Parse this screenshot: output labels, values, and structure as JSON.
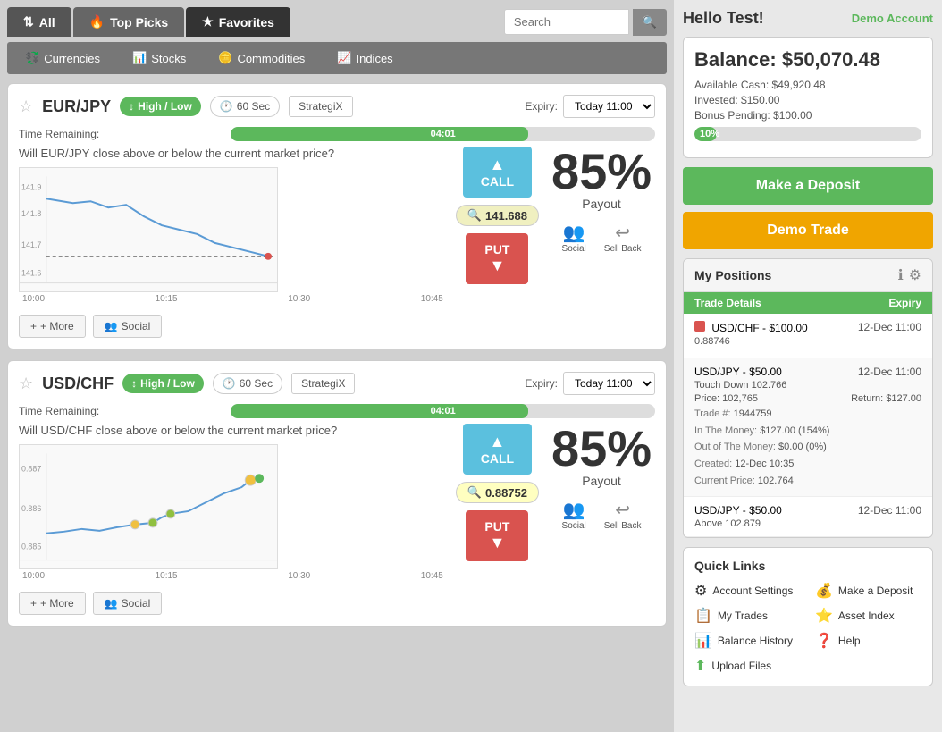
{
  "header": {
    "tabs": [
      {
        "id": "all",
        "label": "All",
        "icon": "⇅",
        "active": false
      },
      {
        "id": "toppicks",
        "label": "Top Picks",
        "icon": "🔥",
        "active": false
      },
      {
        "id": "favorites",
        "label": "Favorites",
        "icon": "★",
        "active": true
      }
    ],
    "search": {
      "placeholder": "Search",
      "button_icon": "🔍"
    },
    "subtabs": [
      {
        "id": "currencies",
        "label": "Currencies",
        "icon": "💱",
        "active": false
      },
      {
        "id": "stocks",
        "label": "Stocks",
        "icon": "📊",
        "active": false
      },
      {
        "id": "commodities",
        "label": "Commodities",
        "icon": "🪙",
        "active": false
      },
      {
        "id": "indices",
        "label": "Indices",
        "icon": "📈",
        "active": false
      }
    ]
  },
  "trades": [
    {
      "id": "eur-jpy",
      "asset": "EUR/JPY",
      "type": "High / Low",
      "duration": "60 Sec",
      "strategy": "StrategiX",
      "expiry_label": "Expiry:",
      "expiry_value": "Today 11:00",
      "question": "Will EUR/JPY close above or below the current market price?",
      "time_remaining_label": "Time Remaining:",
      "time_remaining_value": "04:01",
      "time_bar_pct": 70,
      "price": "141.688",
      "payout": "85%",
      "payout_label": "Payout",
      "call_label": "CALL",
      "put_label": "PUT",
      "social_label": "Social",
      "sellback_label": "Sell Back",
      "more_label": "+ More",
      "chart": {
        "y_labels": [
          "141.9",
          "141.8",
          "141.7",
          "141.6"
        ],
        "x_labels": [
          "10:00",
          "10:15",
          "10:30",
          "10:45"
        ]
      }
    },
    {
      "id": "usd-chf",
      "asset": "USD/CHF",
      "type": "High / Low",
      "duration": "60 Sec",
      "strategy": "StrategiX",
      "expiry_label": "Expiry:",
      "expiry_value": "Today 11:00",
      "question": "Will USD/CHF close above or below the current market price?",
      "time_remaining_label": "Time Remaining:",
      "time_remaining_value": "04:01",
      "time_bar_pct": 70,
      "price": "0.88752",
      "payout": "85%",
      "payout_label": "Payout",
      "call_label": "CALL",
      "put_label": "PUT",
      "social_label": "Social",
      "sellback_label": "Sell Back",
      "more_label": "+ More",
      "chart": {
        "y_labels": [
          "0.887",
          "0.886",
          "0.885"
        ],
        "x_labels": [
          "10:00",
          "10:15",
          "10:30",
          "10:45"
        ]
      }
    }
  ],
  "right": {
    "greeting": "Hello Test!",
    "demo_label": "Demo Account",
    "balance_label": "Balance:",
    "balance_value": "$50,070.48",
    "available_cash_label": "Available Cash:",
    "available_cash": "$49,920.48",
    "invested_label": "Invested:",
    "invested": "$150.00",
    "bonus_label": "Bonus Pending:",
    "bonus": "$100.00",
    "progress_pct": 10,
    "progress_text": "10%",
    "deposit_btn": "Make a Deposit",
    "demo_trade_btn": "Demo Trade",
    "positions": {
      "title": "My Positions",
      "col1": "Trade Details",
      "col2": "Expiry",
      "rows": [
        {
          "asset": "USD/CHF - $100.00",
          "expiry": "12-Dec 11:00",
          "price": "0.88746",
          "indicator": "red",
          "details": null
        },
        {
          "asset": "USD/JPY - $50.00",
          "expiry": "12-Dec 11:00",
          "price": null,
          "indicator": null,
          "price_line": "Price: 102,765",
          "return_line": "Return: $127.00",
          "trade_num": "1944759",
          "in_money": "$127.00 (154%)",
          "out_money": "$0.00 (0%)",
          "created": "12-Dec 10:35",
          "current_price": "102.764",
          "touch_down": "Touch Down 102.766",
          "detail_labels": {
            "trade": "Trade #:",
            "in_money": "In The Money:",
            "out_money": "Out of The Money:",
            "created": "Created:",
            "current": "Current Price:"
          }
        },
        {
          "asset": "USD/JPY - $50.00",
          "expiry": "12-Dec 11:00",
          "above_label": "Above 102.879",
          "indicator": null
        }
      ]
    },
    "quick_links": {
      "title": "Quick Links",
      "items": [
        {
          "icon": "⚙",
          "label": "Account Settings",
          "color": "#888"
        },
        {
          "icon": "💰",
          "label": "Make a Deposit",
          "color": "#f0a500"
        },
        {
          "icon": "📋",
          "label": "My Trades",
          "color": "#f0a500"
        },
        {
          "icon": "⭐",
          "label": "Asset Index",
          "color": "#f0a500"
        },
        {
          "icon": "📊",
          "label": "Balance History",
          "color": "#888"
        },
        {
          "icon": "❓",
          "label": "Help",
          "color": "#d9534f"
        },
        {
          "icon": "⬆",
          "label": "Upload Files",
          "color": "#5cb85c"
        }
      ]
    }
  }
}
